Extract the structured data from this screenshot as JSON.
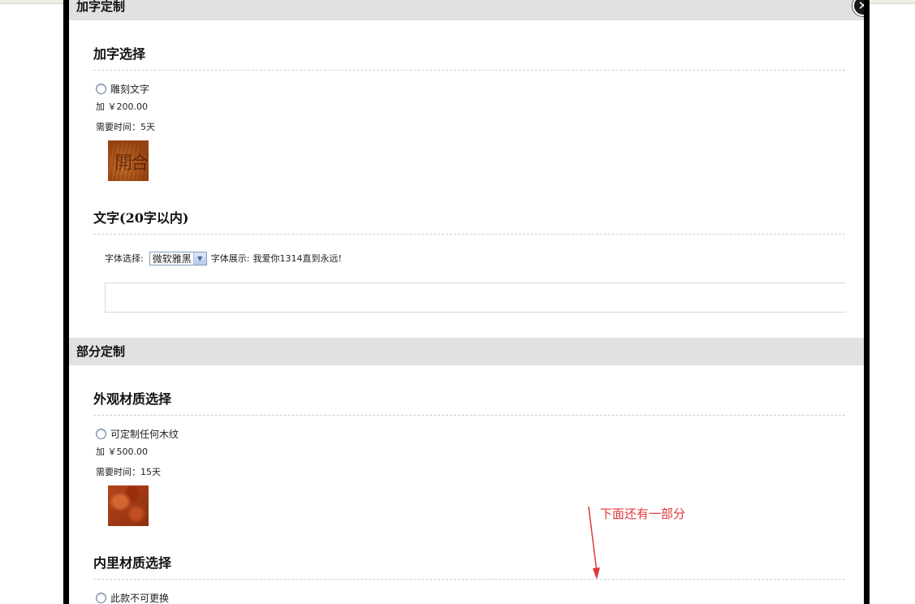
{
  "dialog": {
    "header_top": "加字定制",
    "close_symbol": "✕",
    "header_parts": "部分定制"
  },
  "engrave_section": {
    "title": "加字选择",
    "option_label": "雕刻文字",
    "price": "加 ￥200.00",
    "time": "需要时间：5天",
    "swatch_text": "開合"
  },
  "text_section": {
    "title": "文字(20字以内)",
    "font_select_label": "字体选择:",
    "font_select_value": "微软雅黑",
    "font_preview_label": "字体展示:",
    "font_preview_text": "我爱你1314直到永远!"
  },
  "exterior_section": {
    "title": "外观材质选择",
    "option_label": "可定制任何木纹",
    "price": "加 ￥500.00",
    "time": "需要时间：15天"
  },
  "interior_section": {
    "title": "内里材质选择",
    "option_label": "此款不可更换"
  },
  "annotation": {
    "text": "下面还有一部分",
    "color": "#e0393b"
  }
}
